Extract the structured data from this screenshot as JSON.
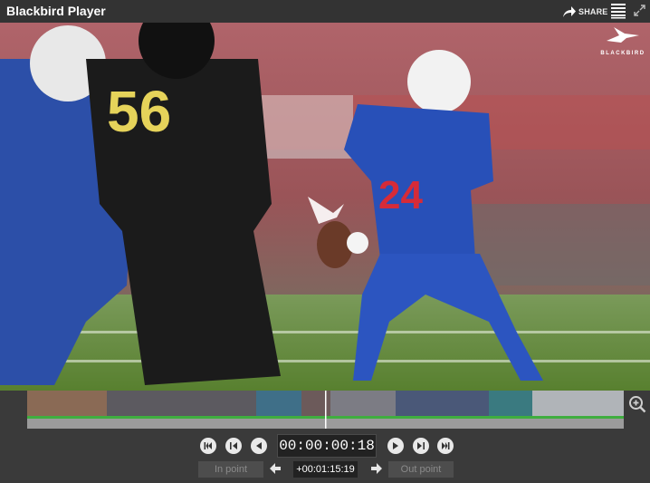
{
  "window": {
    "title": "Blackbird Player"
  },
  "toolbar": {
    "share_label": "SHARE"
  },
  "logo": {
    "text": "BLACKBIRD"
  },
  "player": {
    "timecode": "00:00:00:18"
  },
  "marking": {
    "in_label": "In point",
    "out_label": "Out point",
    "duration": "+00:01:15:19"
  },
  "icons": {
    "share": "share-arrow-icon",
    "menu": "hamburger-menu-icon",
    "expand": "expand-icon",
    "zoom": "zoom-in-icon",
    "go_start": "skip-to-start-icon",
    "step_back_large": "step-back-large-icon",
    "step_back": "step-back-icon",
    "step_forward": "step-forward-icon",
    "step_forward_large": "step-forward-large-icon",
    "go_end": "skip-to-end-icon",
    "arrow_left": "arrow-left-icon",
    "arrow_right": "arrow-right-icon"
  },
  "colors": {
    "accent_green": "#3fae3f",
    "background": "#3a3a3a",
    "titlebar": "#333333"
  }
}
